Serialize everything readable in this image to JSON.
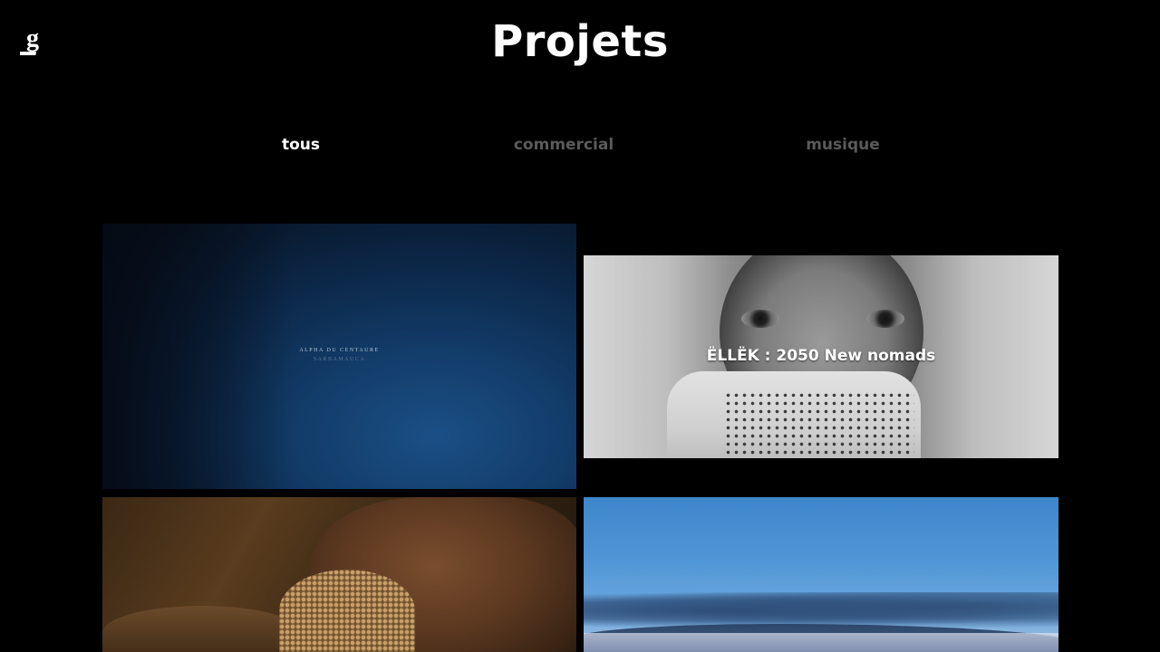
{
  "header": {
    "logo_text": "g",
    "title": "Projets"
  },
  "filters": [
    {
      "label": "tous",
      "active": true
    },
    {
      "label": "commercial",
      "active": false
    },
    {
      "label": "musique",
      "active": false
    }
  ],
  "projects": [
    {
      "title": "",
      "image_text_line1": "ALPHA DU CENTAURE",
      "image_text_line2": "SARBAMAUCA"
    },
    {
      "title": "ËLLËK : 2050 New nomads"
    },
    {
      "title": ""
    },
    {
      "title": ""
    }
  ],
  "colors": {
    "background": "#000000",
    "title": "#ffffff",
    "filter_active": "#ffffff",
    "filter_inactive": "#5a5a5a"
  }
}
